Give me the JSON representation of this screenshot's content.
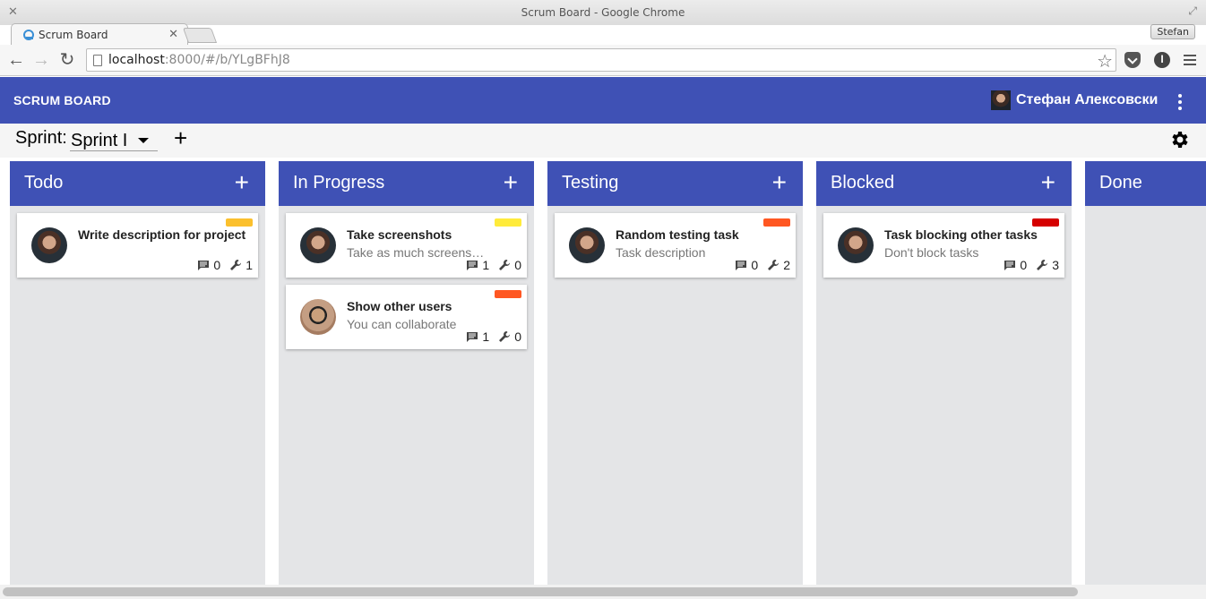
{
  "window": {
    "title": "Scrum Board - Google Chrome",
    "tab_label": "Scrum Board",
    "profile": "Stefan",
    "url_host": "localhost",
    "url_rest": ":8000/#/b/YLgBFhJ8"
  },
  "app": {
    "brand": "SCRUM BOARD",
    "user_name": "Стефан Алексовски"
  },
  "sprint": {
    "label": "Sprint:",
    "selected": "Sprint I"
  },
  "columns": [
    {
      "title": "Todo",
      "tasks": [
        {
          "title": "Write description for project",
          "description": "",
          "tag_color": "#fbc02d",
          "comments": "0",
          "subtasks": "1",
          "avatar": "user-stefan"
        }
      ]
    },
    {
      "title": "In Progress",
      "tasks": [
        {
          "title": "Take screenshots",
          "description": "Take as much screenshots as possible",
          "tag_color": "#ffeb3b",
          "comments": "1",
          "subtasks": "0",
          "avatar": "user-stefan"
        },
        {
          "title": "Show other users",
          "description": "You can collaborate",
          "tag_color": "#ff5722",
          "comments": "1",
          "subtasks": "0",
          "avatar": "user-other"
        }
      ]
    },
    {
      "title": "Testing",
      "tasks": [
        {
          "title": "Random testing task",
          "description": "Task description",
          "tag_color": "#ff5722",
          "comments": "0",
          "subtasks": "2",
          "avatar": "user-stefan"
        }
      ]
    },
    {
      "title": "Blocked",
      "tasks": [
        {
          "title": "Task blocking other tasks",
          "description": "Don't block tasks",
          "tag_color": "#d50000",
          "comments": "0",
          "subtasks": "3",
          "avatar": "user-stefan"
        }
      ]
    },
    {
      "title": "Done",
      "tasks": []
    }
  ],
  "colors": {
    "primary": "#3f51b5",
    "column_bg": "#e4e5e7"
  }
}
